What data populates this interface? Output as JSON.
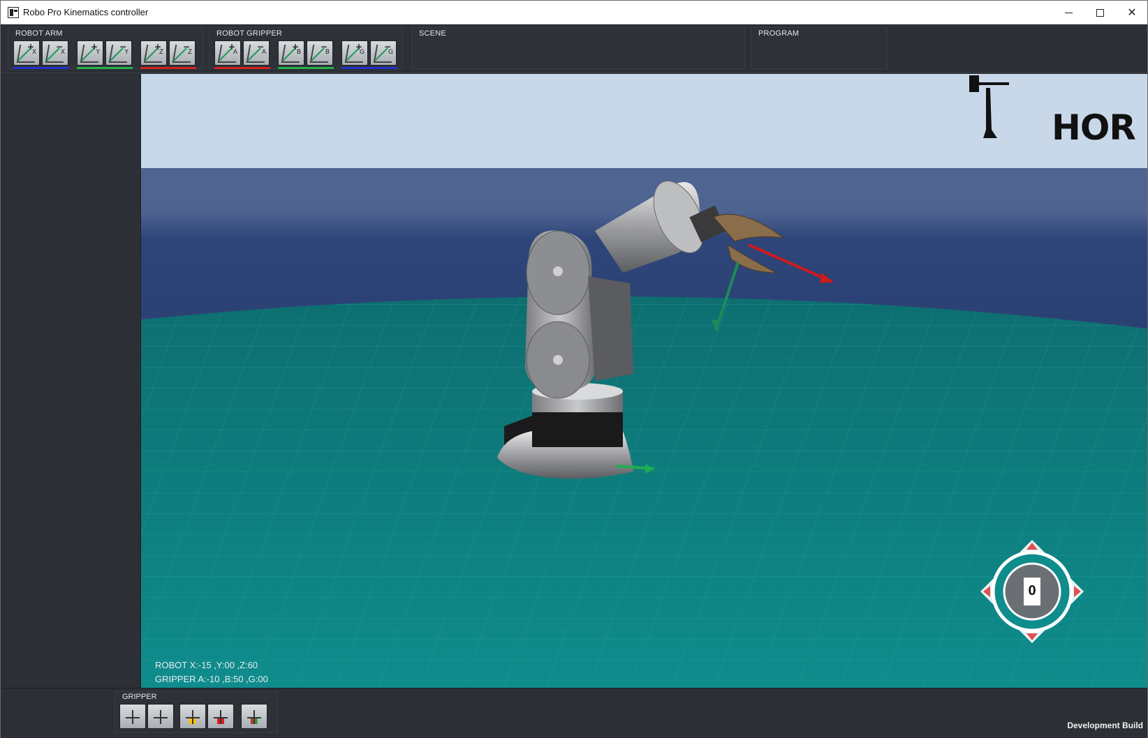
{
  "window": {
    "title": "Robo Pro Kinematics controller"
  },
  "toolbar": {
    "robot_arm": {
      "label": "ROBOT ARM",
      "buttons": [
        {
          "sign": "+",
          "axis": "X"
        },
        {
          "sign": "−",
          "axis": "X"
        },
        {
          "sign": "+",
          "axis": "Y"
        },
        {
          "sign": "−",
          "axis": "Y"
        },
        {
          "sign": "+",
          "axis": "Z"
        },
        {
          "sign": "−",
          "axis": "Z"
        }
      ]
    },
    "robot_gripper": {
      "label": "ROBOT GRIPPER",
      "buttons": [
        {
          "sign": "+",
          "axis": "A"
        },
        {
          "sign": "−",
          "axis": "A"
        },
        {
          "sign": "+",
          "axis": "B"
        },
        {
          "sign": "−",
          "axis": "B"
        },
        {
          "sign": "+",
          "axis": "G"
        },
        {
          "sign": "−",
          "axis": "G"
        }
      ]
    },
    "scene": {
      "label": "SCENE"
    },
    "program": {
      "label": "PROGRAM"
    },
    "colors": {
      "x_axis": "#2233cc",
      "y_axis": "#22b14c",
      "z_axis": "#d42020"
    }
  },
  "viewport": {
    "logo": "HOR",
    "status_robot": "ROBOT    X:-15 ,Y:00 ,Z:60",
    "status_gripper": "GRIPPER A:-10 ,B:50 ,G:00",
    "nav_gizmo_label": "0",
    "colors": {
      "sky_top": "#c9d9ea",
      "horizon": "#2b3d72",
      "floor": "#0f8a8a"
    }
  },
  "bottombar": {
    "gripper_label": "GRIPPER",
    "buttons": [
      "open-gripper",
      "close-gripper",
      "attach-object",
      "detach-object",
      "gripper-axis"
    ],
    "dev_build": "Development Build"
  }
}
